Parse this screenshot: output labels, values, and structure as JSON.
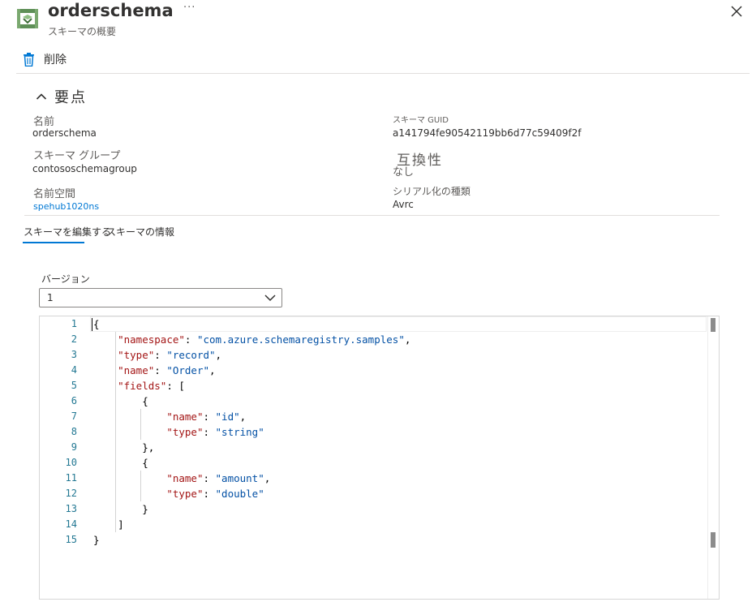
{
  "header": {
    "title": "orderschema",
    "subtitle": "スキーマの概要",
    "more_label": "···"
  },
  "commands": {
    "delete_label": "削除"
  },
  "essentials": {
    "heading": "要点",
    "name_label": "名前",
    "name_value": "orderschema",
    "group_label": "スキーマ グループ",
    "group_value": "contososchemagroup",
    "namespace_label": "名前空間",
    "namespace_value": "spehub1020ns",
    "guid_label": "スキーマ GUID",
    "guid_value": "a141794fe90542119bb6d77c59409f2f",
    "compat_label": "互換性",
    "compat_value": "なし",
    "serial_label": "シリアル化の種類",
    "serial_value": "Avrc"
  },
  "tabs": [
    {
      "label": "スキーマを編集する",
      "active": true
    },
    {
      "label": "スキーマの情報",
      "active": false
    }
  ],
  "version": {
    "label": "バージョン",
    "selected": "1"
  },
  "editor": {
    "line_numbers": [
      "1",
      "2",
      "3",
      "4",
      "5",
      "6",
      "7",
      "8",
      "9",
      "10",
      "11",
      "12",
      "13",
      "14",
      "15"
    ],
    "lines": [
      [
        {
          "t": "{",
          "c": "p"
        }
      ],
      [
        {
          "t": "    ",
          "c": "p"
        },
        {
          "t": "\"namespace\"",
          "c": "k"
        },
        {
          "t": ": ",
          "c": "p"
        },
        {
          "t": "\"com.azure.schemaregistry.samples\"",
          "c": "s"
        },
        {
          "t": ",",
          "c": "p"
        }
      ],
      [
        {
          "t": "    ",
          "c": "p"
        },
        {
          "t": "\"type\"",
          "c": "k"
        },
        {
          "t": ": ",
          "c": "p"
        },
        {
          "t": "\"record\"",
          "c": "s"
        },
        {
          "t": ",",
          "c": "p"
        }
      ],
      [
        {
          "t": "    ",
          "c": "p"
        },
        {
          "t": "\"name\"",
          "c": "k"
        },
        {
          "t": ": ",
          "c": "p"
        },
        {
          "t": "\"Order\"",
          "c": "s"
        },
        {
          "t": ",",
          "c": "p"
        }
      ],
      [
        {
          "t": "    ",
          "c": "p"
        },
        {
          "t": "\"fields\"",
          "c": "k"
        },
        {
          "t": ": [",
          "c": "p"
        }
      ],
      [
        {
          "t": "        {",
          "c": "p"
        }
      ],
      [
        {
          "t": "            ",
          "c": "p"
        },
        {
          "t": "\"name\"",
          "c": "k"
        },
        {
          "t": ": ",
          "c": "p"
        },
        {
          "t": "\"id\"",
          "c": "s"
        },
        {
          "t": ",",
          "c": "p"
        }
      ],
      [
        {
          "t": "            ",
          "c": "p"
        },
        {
          "t": "\"type\"",
          "c": "k"
        },
        {
          "t": ": ",
          "c": "p"
        },
        {
          "t": "\"string\"",
          "c": "s"
        }
      ],
      [
        {
          "t": "        },",
          "c": "p"
        }
      ],
      [
        {
          "t": "        {",
          "c": "p"
        }
      ],
      [
        {
          "t": "            ",
          "c": "p"
        },
        {
          "t": "\"name\"",
          "c": "k"
        },
        {
          "t": ": ",
          "c": "p"
        },
        {
          "t": "\"amount\"",
          "c": "s"
        },
        {
          "t": ",",
          "c": "p"
        }
      ],
      [
        {
          "t": "            ",
          "c": "p"
        },
        {
          "t": "\"type\"",
          "c": "k"
        },
        {
          "t": ": ",
          "c": "p"
        },
        {
          "t": "\"double\"",
          "c": "s"
        }
      ],
      [
        {
          "t": "        }",
          "c": "p"
        }
      ],
      [
        {
          "t": "    ]",
          "c": "p"
        }
      ],
      [
        {
          "t": "}",
          "c": "p"
        }
      ]
    ]
  },
  "icons": {
    "resource": "schema-icon",
    "close": "close-icon",
    "delete": "trash-icon",
    "collapse": "chevron-up-icon",
    "dropdown": "chevron-down-icon"
  },
  "colors": {
    "accent": "#0078d4",
    "json_key": "#a31515",
    "json_string": "#0451a5",
    "line_number": "#237893",
    "resource_icon": "#4f8a4a"
  }
}
